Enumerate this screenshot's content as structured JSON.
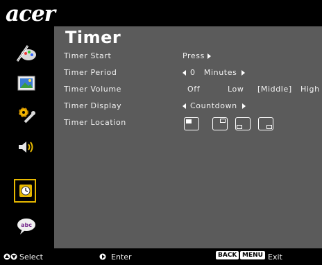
{
  "brand": "acer",
  "menu": {
    "title": "Timer",
    "rows": [
      {
        "label": "Timer Start",
        "value": "Press"
      },
      {
        "label": "Timer Period",
        "value_num": "0",
        "value_unit": "Minutes"
      },
      {
        "label": "Timer Volume",
        "options": [
          "Off",
          "Low",
          "[Middle]",
          "High"
        ]
      },
      {
        "label": "Timer Display",
        "value": "Countdown"
      },
      {
        "label": "Timer Location"
      }
    ],
    "location_options": [
      "top-left",
      "top-right",
      "bottom-left",
      "bottom-right"
    ],
    "location_selected": "top-left"
  },
  "sidebar": {
    "icons": [
      "color-wand-icon",
      "picture-icon",
      "settings-tools-icon",
      "speaker-icon",
      "timer-icon",
      "language-icon"
    ],
    "selected": "timer-icon"
  },
  "footer": {
    "select_label": "Select",
    "enter_label": "Enter",
    "back_key": "BACK",
    "menu_key": "MENU",
    "exit_label": "Exit"
  },
  "colors": {
    "panel": "#5b5b5b",
    "background": "#000000",
    "highlight": "#e6b800"
  }
}
